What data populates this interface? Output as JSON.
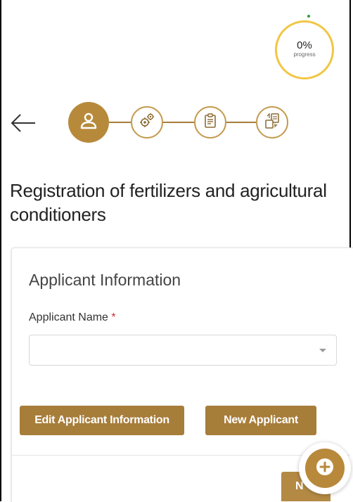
{
  "progress": {
    "value": "0%",
    "label": "progress"
  },
  "steps": [
    {
      "icon": "user-icon",
      "state": "active"
    },
    {
      "icon": "gears-icon",
      "state": "inactive"
    },
    {
      "icon": "clipboard-icon",
      "state": "inactive"
    },
    {
      "icon": "documents-exchange-icon",
      "state": "inactive"
    }
  ],
  "page": {
    "title": "Registration of fertilizers and agricultural conditioners"
  },
  "applicant": {
    "section_title": "Applicant Information",
    "name_label": "Applicant Name",
    "required_mark": "*",
    "name_value": ""
  },
  "buttons": {
    "edit": "Edit Applicant Information",
    "new": "New Applicant",
    "next": "N"
  },
  "colors": {
    "accent": "#a77d3a",
    "progress_ring": "#f1c644",
    "required": "#d62f2f"
  }
}
